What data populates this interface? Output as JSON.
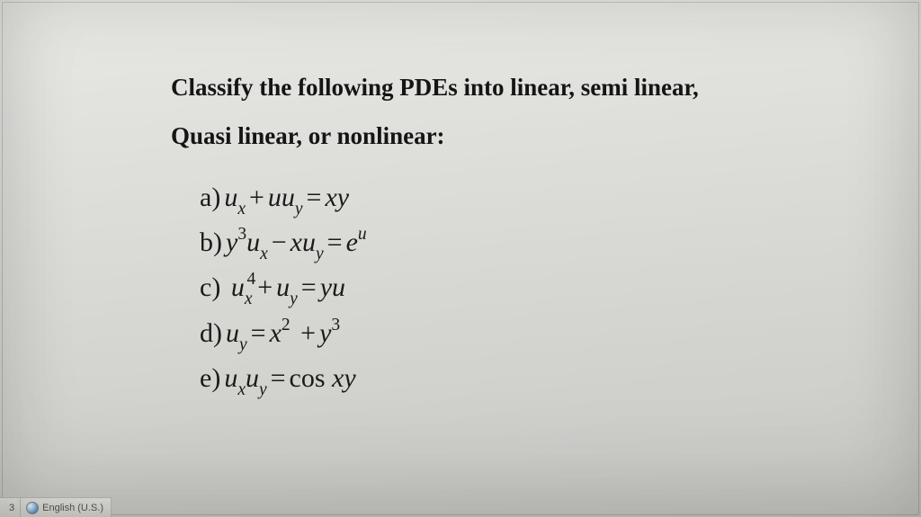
{
  "heading": {
    "line1": "Classify the following PDEs into linear, semi linear,",
    "line2": "Quasi linear, or nonlinear:"
  },
  "equations": {
    "a": {
      "label": "a)"
    },
    "b": {
      "label": "b)"
    },
    "c": {
      "label": "c)"
    },
    "d": {
      "label": "d)"
    },
    "e": {
      "label": "e)"
    }
  },
  "status_bar": {
    "page_number": "3",
    "language": "English (U.S.)"
  }
}
